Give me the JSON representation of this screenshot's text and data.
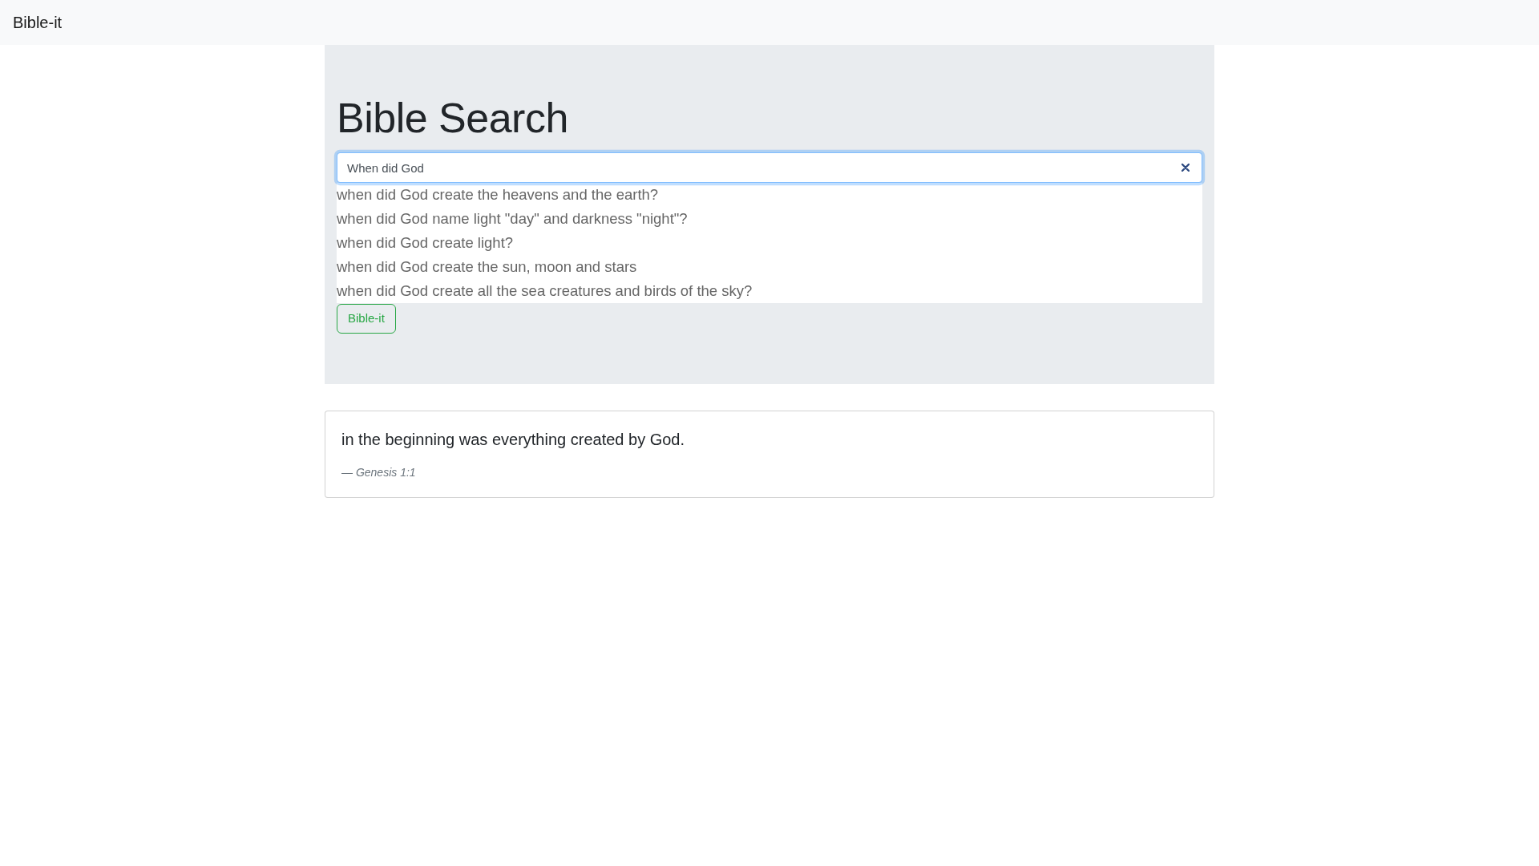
{
  "navbar": {
    "brand": "Bible-it"
  },
  "hero": {
    "title": "Bible Search",
    "search": {
      "value": "When did God",
      "focused": true
    },
    "suggestions": [
      {
        "text": "when did God create the heavens and the earth?",
        "selected": false
      },
      {
        "text": "when did God name light \"day\" and darkness \"night\"?",
        "selected": false
      },
      {
        "text": "when did God create light?",
        "selected": false
      },
      {
        "text": "when did God create the sun, moon and stars",
        "selected": false
      },
      {
        "text": "when did God create all the sea creatures and birds of the sky?",
        "selected": false
      }
    ],
    "button": "Bible-it"
  },
  "result": {
    "quote": "in the beginning was everything created by God.",
    "source": "— Genesis 1:1"
  }
}
